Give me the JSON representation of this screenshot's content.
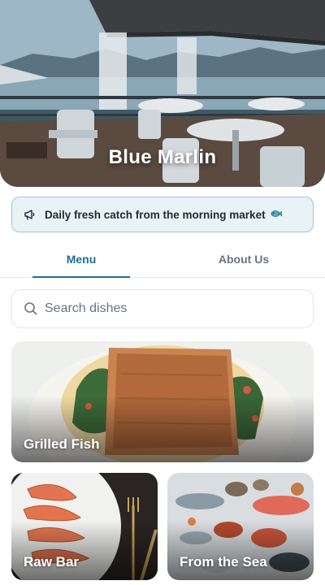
{
  "restaurant": {
    "name": "Blue Marlin"
  },
  "banner": {
    "text": "Daily fresh catch from the morning market",
    "icon": "megaphone-icon",
    "emoji": "fish-emoji"
  },
  "tabs": [
    {
      "label": "Menu",
      "active": true
    },
    {
      "label": "About Us",
      "active": false
    }
  ],
  "search": {
    "placeholder": "Search dishes",
    "value": ""
  },
  "categories": [
    {
      "label": "Grilled Fish"
    },
    {
      "label": "Raw Bar"
    },
    {
      "label": "From the Sea"
    }
  ],
  "colors": {
    "accent": "#1f6f86",
    "banner_bg": "#e8f3f5",
    "banner_border": "#9cc7d3"
  }
}
